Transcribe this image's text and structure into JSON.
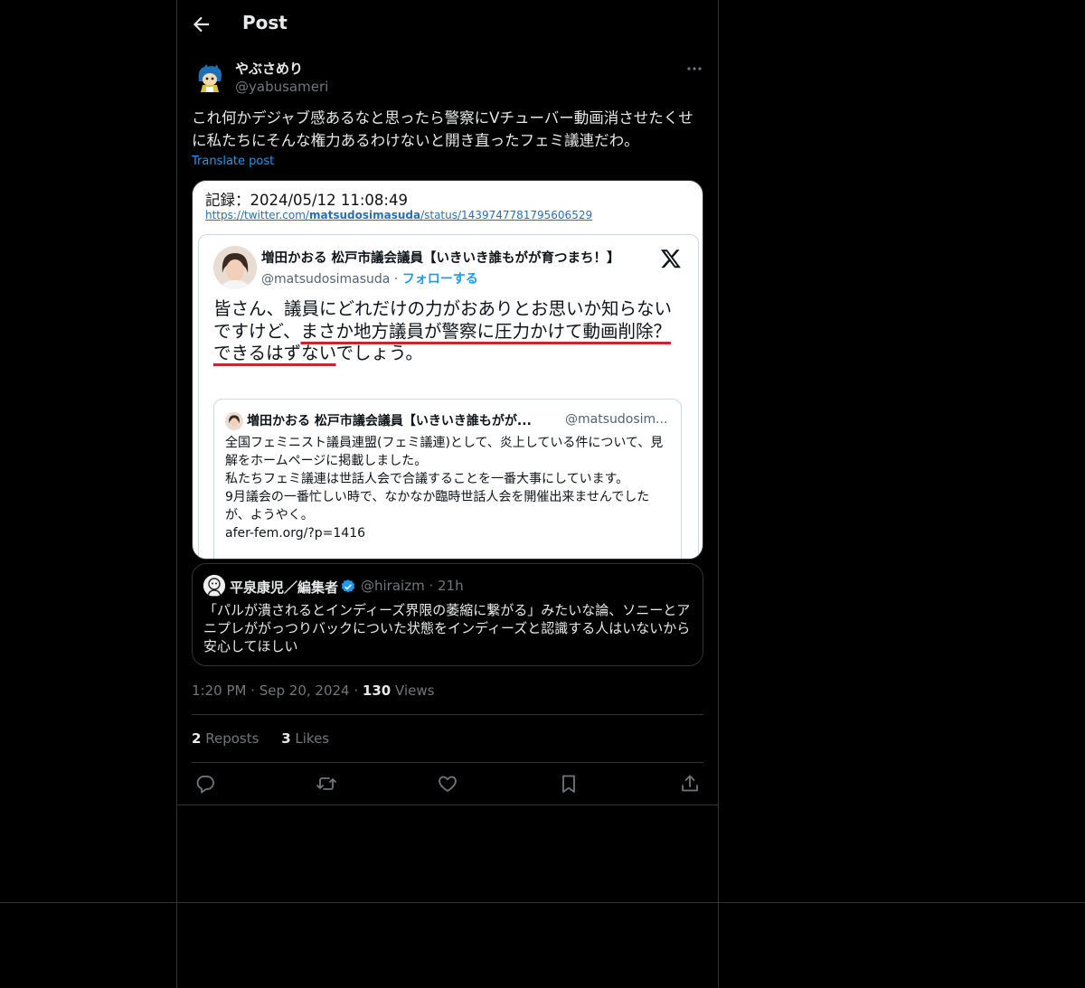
{
  "header": {
    "title": "Post"
  },
  "author": {
    "display_name": "やぶさめり",
    "handle": "@yabusameri"
  },
  "post": {
    "text": "これ何かデジャブ感あるなと思ったら警察にVチューバー動画消させたくせに私たちにそんな権力あるわけないと開き直ったフェミ議連だわ。",
    "translate_label": "Translate post"
  },
  "media": {
    "record_label": "記録：2024/05/12 11:08:49",
    "record_url_prefix": "https://twitter.com/",
    "record_url_user": "matsudosimasuda",
    "record_url_suffix": "/status/1439747781795606529",
    "embed": {
      "name": "増田かおる 松戸市議会議員【いきいき誰もがが育つまち！】",
      "handle": "@matsudosimasuda",
      "separator": " · ",
      "follow": "フォローする",
      "text_a": "皆さん、議員にどれだけの力がおありとお思いか知らないですけど、",
      "text_b": "まさか地方議員が警察に圧力かけて動画削除？",
      "text_c": "できるはずない",
      "text_d": "でしょう。",
      "quoted": {
        "name": "増田かおる 松戸市議会議員【いきいき誰もがが...",
        "handle": "@matsudosim...",
        "line1": "全国フェミニスト議員連盟(フェミ議連)として、炎上している件について、見解をホームページに掲載しました。",
        "line2": "私たちフェミ議連は世話人会で合議することを一番大事にしています。",
        "line3": "9月議会の一番忙しい時で、なかなか臨時世話人会を開催出来ませんでしたが、ようやく。",
        "line4": "afer-fem.org/?p=1416"
      }
    }
  },
  "quote": {
    "name": "平泉康児／編集者",
    "handle_time": "@hiraizm · 21h",
    "text": "「パルが潰されるとインディーズ界限の萎縮に繋がる」みたいな論、ソニーとアニプレががっつりバックについた状態をインディーズと認識する人はいないから安心してほしい"
  },
  "meta": {
    "time": "1:20 PM",
    "date": "Sep 20, 2024",
    "views_count": "130",
    "views_label": "Views"
  },
  "stats": {
    "reposts_count": "2",
    "reposts_label": "Reposts",
    "likes_count": "3",
    "likes_label": "Likes"
  },
  "colors": {
    "background": "#000000",
    "accent": "#1d9bf0",
    "border": "#2f3336",
    "muted": "#71767b",
    "underline": "#d02030"
  },
  "icons": [
    "back-arrow-icon",
    "more-icon",
    "x-logo-icon",
    "verified-badge-icon",
    "reply-icon",
    "repost-icon",
    "like-icon",
    "bookmark-icon",
    "share-icon"
  ]
}
